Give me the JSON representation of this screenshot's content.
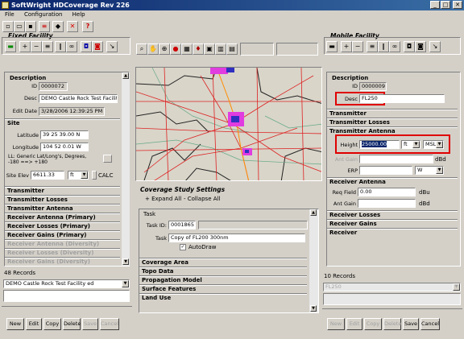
{
  "window": {
    "title": "SoftWright HDCoverage Rev 226",
    "min": "_",
    "max": "□",
    "close": "✕"
  },
  "menu": [
    "File",
    "Configuration",
    "Help"
  ],
  "fixed": {
    "title": "Fixed Facility",
    "description": {
      "header": "Description",
      "id_label": "ID",
      "id": "0000072",
      "desc_label": "Desc",
      "desc": "DEMO Castle Rock Test Facilit",
      "edit_label": "Edit Date",
      "edit": "3/28/2006 12:39:25 PM"
    },
    "site": {
      "header": "Site",
      "lat_label": "Latitude",
      "lat": "39 25 39.00 N",
      "lon_label": "Longitude",
      "lon": "104 52 0.01 W",
      "ll_note": "LL: Generic Lat/Long's, Degrees, -180 ==> +180",
      "elev_label": "Site Elev",
      "elev": "6611.33",
      "elev_unit": "ft",
      "calc": "CALC"
    },
    "sections": [
      "Transmitter",
      "Transmitter Losses",
      "Transmitter Antenna",
      "Receiver Antenna (Primary)",
      "Receiver Losses (Primary)",
      "Receiver Gains (Primary)",
      "Receiver Antenna (Diversity)",
      "Receiver Losses (Diversity)",
      "Receiver Gains (Diversity)"
    ],
    "records": "48 Records",
    "selected": "DEMO Castle Rock Test Facility ed",
    "buttons": [
      "New",
      "Edit",
      "Copy",
      "Delete",
      "Save",
      "Cancel"
    ]
  },
  "mobile": {
    "title": "Mobile Facility",
    "description": {
      "header": "Description",
      "id_label": "ID",
      "id": "0000009",
      "desc_label": "Desc",
      "desc": "FL250"
    },
    "sections1": [
      "Transmitter",
      "Transmitter Losses",
      "Transmitter Antenna"
    ],
    "antenna": {
      "height_label": "Height",
      "height": "25000.00",
      "height_unit": "ft",
      "ref": "MSL",
      "gain_label": "Ant Gain",
      "gain_unit": "dBd",
      "erp_label": "ERP",
      "erp_unit": "W"
    },
    "rx": {
      "header": "Receiver Antenna",
      "req_label": "Req Field",
      "req": "0.00",
      "req_unit": "dBu",
      "gain_label": "Ant Gain",
      "gain": "",
      "gain_unit": "dBd"
    },
    "sections2": [
      "Receiver Losses",
      "Receiver Gains",
      "Receiver"
    ],
    "records": "10 Records",
    "selected": "FL250",
    "buttons": [
      "New",
      "Edit",
      "Copy",
      "Delete",
      "Save",
      "Cancel"
    ]
  },
  "study": {
    "title": "Coverage Study Settings",
    "expand": "+ Expand All",
    "collapse": "- Collapse All",
    "task": {
      "header": "Task",
      "id_label": "Task ID:",
      "id": "0001865",
      "task_label": "Task",
      "task": "Copy of FL200 300nm",
      "autodraw": "AutoDraw"
    },
    "sections": [
      "Coverage Area",
      "Topo Data",
      "Propagation Model",
      "Surface Features",
      "Land Use"
    ]
  }
}
